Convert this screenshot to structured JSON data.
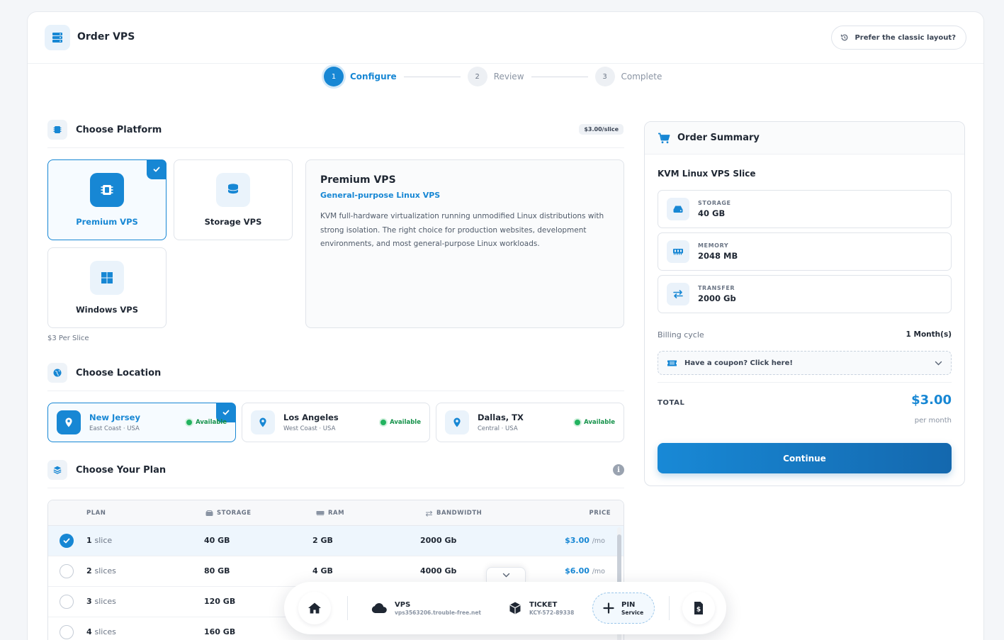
{
  "header": {
    "title": "Order VPS",
    "classic_label": "Prefer the classic layout?"
  },
  "stepper": [
    {
      "num": "1",
      "label": "Configure"
    },
    {
      "num": "2",
      "label": "Review"
    },
    {
      "num": "3",
      "label": "Complete"
    }
  ],
  "platform": {
    "heading": "Choose Platform",
    "price_badge": "$3.00/slice",
    "options": [
      "Premium VPS",
      "Storage VPS",
      "Windows VPS"
    ],
    "per_slice": "$3 Per Slice",
    "detail": {
      "title": "Premium VPS",
      "subtitle": "General-purpose Linux VPS",
      "body": "KVM full-hardware virtualization running unmodified Linux distributions with strong isolation. The right choice for production websites, development environments, and most general-purpose Linux workloads."
    }
  },
  "location": {
    "heading": "Choose Location",
    "options": [
      {
        "city": "New Jersey",
        "region": "East Coast · USA",
        "status": "Available"
      },
      {
        "city": "Los Angeles",
        "region": "West Coast · USA",
        "status": "Available"
      },
      {
        "city": "Dallas, TX",
        "region": "Central · USA",
        "status": "Available"
      }
    ]
  },
  "plan": {
    "heading": "Choose Your Plan",
    "columns": {
      "plan": "PLAN",
      "storage": "STORAGE",
      "ram": "RAM",
      "bandwidth": "BANDWIDTH",
      "price": "PRICE"
    },
    "rows": [
      {
        "count": "1",
        "unit": "slice",
        "storage": "40 GB",
        "ram": "2 GB",
        "bandwidth": "2000 Gb",
        "price": "$3.00",
        "per": "/mo"
      },
      {
        "count": "2",
        "unit": "slices",
        "storage": "80 GB",
        "ram": "4 GB",
        "bandwidth": "4000 Gb",
        "price": "$6.00",
        "per": "/mo"
      },
      {
        "count": "3",
        "unit": "slices",
        "storage": "120 GB",
        "ram": "",
        "bandwidth": "",
        "price": "",
        "per": ""
      },
      {
        "count": "4",
        "unit": "slices",
        "storage": "160 GB",
        "ram": "",
        "bandwidth": "",
        "price": "",
        "per": ""
      }
    ]
  },
  "summary": {
    "heading": "Order Summary",
    "product": "KVM Linux VPS Slice",
    "specs": [
      {
        "label": "STORAGE",
        "value": "40 GB"
      },
      {
        "label": "MEMORY",
        "value": "2048 MB"
      },
      {
        "label": "TRANSFER",
        "value": "2000 Gb"
      }
    ],
    "billing_label": "Billing cycle",
    "billing_value": "1 Month(s)",
    "coupon": "Have a coupon? Click here!",
    "total_label": "TOTAL",
    "total_value": "$3.00",
    "per_month": "per month",
    "continue": "Continue"
  },
  "dock": {
    "vps_title": "VPS",
    "vps_sub": "vps3563206.trouble-free.net",
    "ticket_title": "TICKET",
    "ticket_sub": "KCY-572-89338",
    "pin_title": "PIN",
    "pin_sub": "Service"
  },
  "colors": {
    "accent": "#1787d4",
    "available": "#22b35f"
  }
}
